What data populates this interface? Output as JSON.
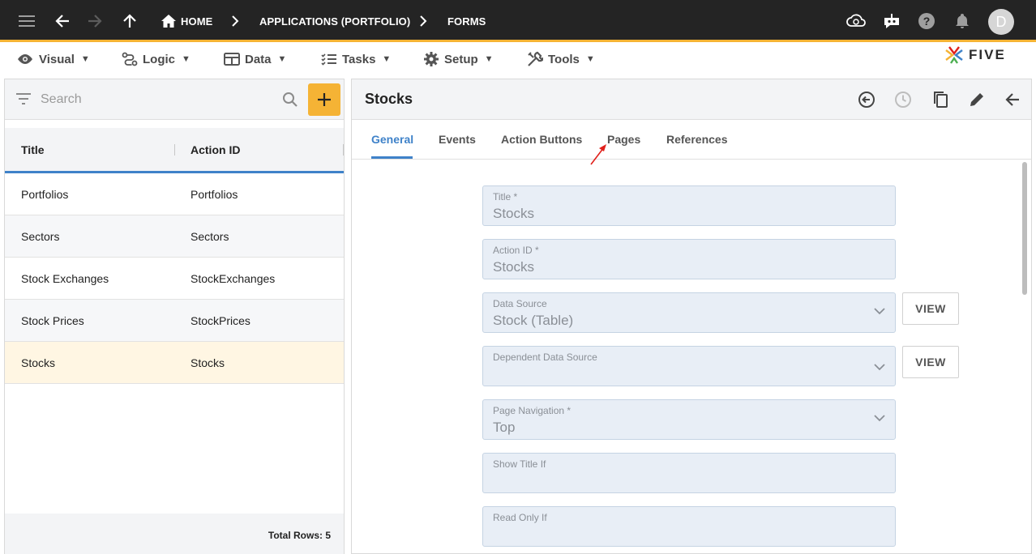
{
  "topbar": {
    "breadcrumbs": {
      "home": "HOME",
      "applications": "APPLICATIONS (PORTFOLIO)",
      "forms": "FORMS"
    },
    "avatar_initial": "D"
  },
  "menubar": {
    "items": [
      {
        "label": "Visual",
        "icon": "eye-icon"
      },
      {
        "label": "Logic",
        "icon": "logic-icon"
      },
      {
        "label": "Data",
        "icon": "table-icon"
      },
      {
        "label": "Tasks",
        "icon": "checklist-icon"
      },
      {
        "label": "Setup",
        "icon": "gear-icon"
      },
      {
        "label": "Tools",
        "icon": "tools-icon"
      }
    ],
    "caret": "▼",
    "logo_text": "FIVE"
  },
  "list": {
    "search_placeholder": "Search",
    "columns": [
      "Title",
      "Action ID"
    ],
    "rows": [
      {
        "title": "Portfolios",
        "action_id": "Portfolios"
      },
      {
        "title": "Sectors",
        "action_id": "Sectors"
      },
      {
        "title": "Stock Exchanges",
        "action_id": "StockExchanges"
      },
      {
        "title": "Stock Prices",
        "action_id": "StockPrices"
      },
      {
        "title": "Stocks",
        "action_id": "Stocks"
      }
    ],
    "selected_row": 4,
    "total_rows": "Total Rows: 5"
  },
  "detail": {
    "title": "Stocks",
    "tabs": [
      "General",
      "Events",
      "Action Buttons",
      "Pages",
      "References"
    ],
    "active_tab": "General",
    "fields": {
      "title": {
        "label": "Title *",
        "value": "Stocks"
      },
      "action_id": {
        "label": "Action ID *",
        "value": "Stocks"
      },
      "data_source": {
        "label": "Data Source",
        "value": "Stock (Table)"
      },
      "dependent_data_source": {
        "label": "Dependent Data Source",
        "value": ""
      },
      "page_navigation": {
        "label": "Page Navigation *",
        "value": "Top"
      },
      "show_title_if": {
        "label": "Show Title If",
        "value": ""
      },
      "read_only_if": {
        "label": "Read Only If",
        "value": ""
      }
    },
    "view_label": "VIEW"
  },
  "colors": {
    "topbar_bg": "#242424",
    "accent_yellow": "#f5b335",
    "accent_blue": "#3f82c9",
    "selected_row_bg": "#fff6e3",
    "field_bg": "#e8eef6",
    "annotation_red": "#e0201b"
  }
}
